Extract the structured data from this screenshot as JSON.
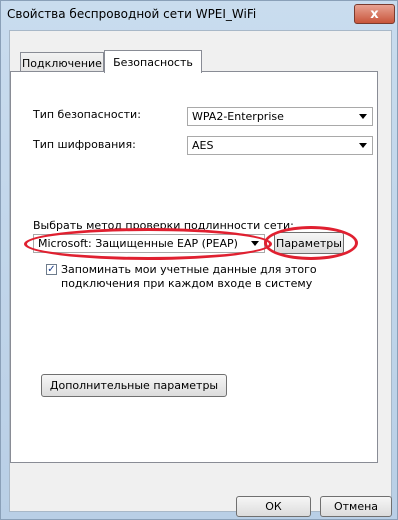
{
  "window": {
    "title": "Свойства беспроводной сети WPEI_WiFi",
    "close_label": "x"
  },
  "tabs": [
    {
      "label": "Подключение",
      "active": false
    },
    {
      "label": "Безопасность",
      "active": true
    }
  ],
  "security": {
    "type_label": "Тип безопасности:",
    "type_value": "WPA2-Enterprise",
    "encryption_label": "Тип шифрования:",
    "encryption_value": "AES",
    "auth_method_label": "Выбрать метод проверки подлинности сети:",
    "auth_method_value": "Microsoft: Защищенные EAP (PEAP)",
    "params_button": "Параметры",
    "remember_checked": true,
    "remember_line1": "Запоминать мои учетные данные для этого",
    "remember_line2": "подключения при каждом входе в систему",
    "advanced_button": "Дополнительные параметры"
  },
  "footer": {
    "ok_button": "ОК",
    "cancel_button": "Отмена"
  },
  "annotation_color": "#e02030"
}
